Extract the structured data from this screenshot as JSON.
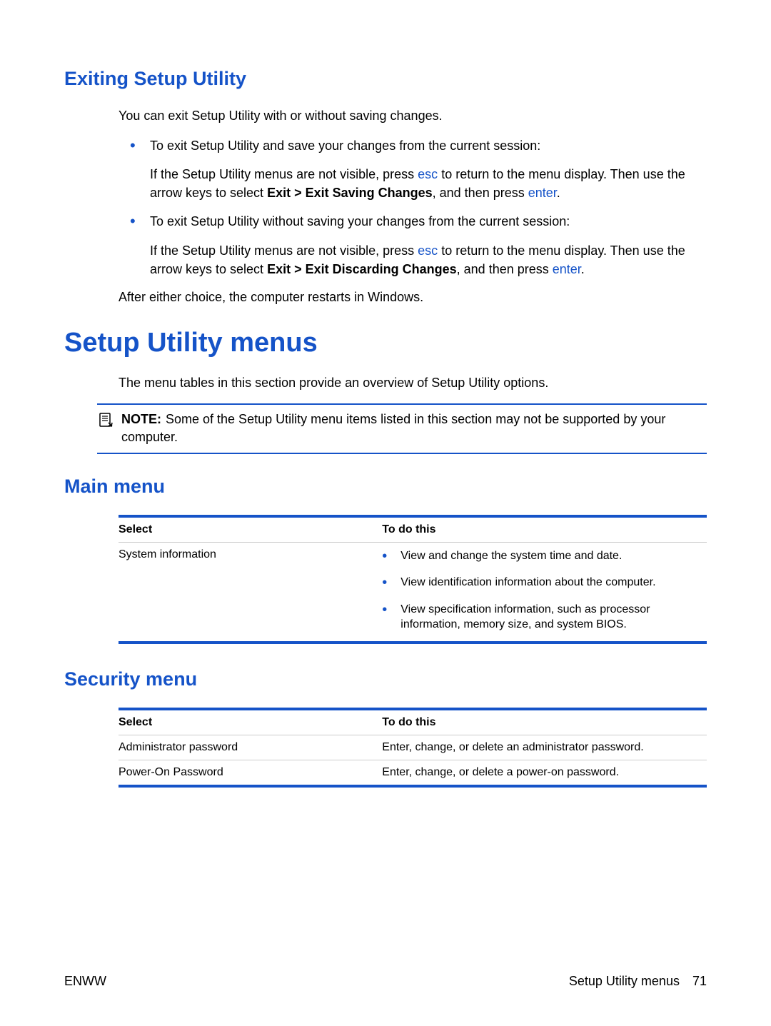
{
  "section1": {
    "heading": "Exiting Setup Utility",
    "intro": "You can exit Setup Utility with or without saving changes.",
    "bullet1_lead": "To exit Setup Utility and save your changes from the current session:",
    "bullet1_para_part1": "If the Setup Utility menus are not visible, press ",
    "bullet1_key1": "esc",
    "bullet1_para_part2": " to return to the menu display. Then use the arrow keys to select ",
    "bullet1_bold": "Exit > Exit Saving Changes",
    "bullet1_para_part3": ", and then press ",
    "bullet1_key2": "enter",
    "bullet1_para_part4": ".",
    "bullet2_lead": "To exit Setup Utility without saving your changes from the current session:",
    "bullet2_para_part1": "If the Setup Utility menus are not visible, press ",
    "bullet2_key1": "esc",
    "bullet2_para_part2": " to return to the menu display. Then use the arrow keys to select ",
    "bullet2_bold": "Exit > Exit Discarding Changes",
    "bullet2_para_part3": ", and then press ",
    "bullet2_key2": "enter",
    "bullet2_para_part4": ".",
    "outro": "After either choice, the computer restarts in Windows."
  },
  "section2": {
    "heading": "Setup Utility menus",
    "intro": "The menu tables in this section provide an overview of Setup Utility options.",
    "note_label": "NOTE:",
    "note_text": "Some of the Setup Utility menu items listed in this section may not be supported by your computer."
  },
  "main_menu": {
    "heading": "Main menu",
    "col_select": "Select",
    "col_todo": "To do this",
    "row1_left": "System information",
    "row1_b1": "View and change the system time and date.",
    "row1_b2": "View identification information about the computer.",
    "row1_b3": "View specification information, such as processor information, memory size, and system BIOS."
  },
  "security_menu": {
    "heading": "Security menu",
    "col_select": "Select",
    "col_todo": "To do this",
    "row1_left": "Administrator password",
    "row1_right": "Enter, change, or delete an administrator password.",
    "row2_left": "Power-On Password",
    "row2_right": "Enter, change, or delete a power-on password."
  },
  "footer": {
    "left": "ENWW",
    "right_label": "Setup Utility menus",
    "page": "71"
  }
}
